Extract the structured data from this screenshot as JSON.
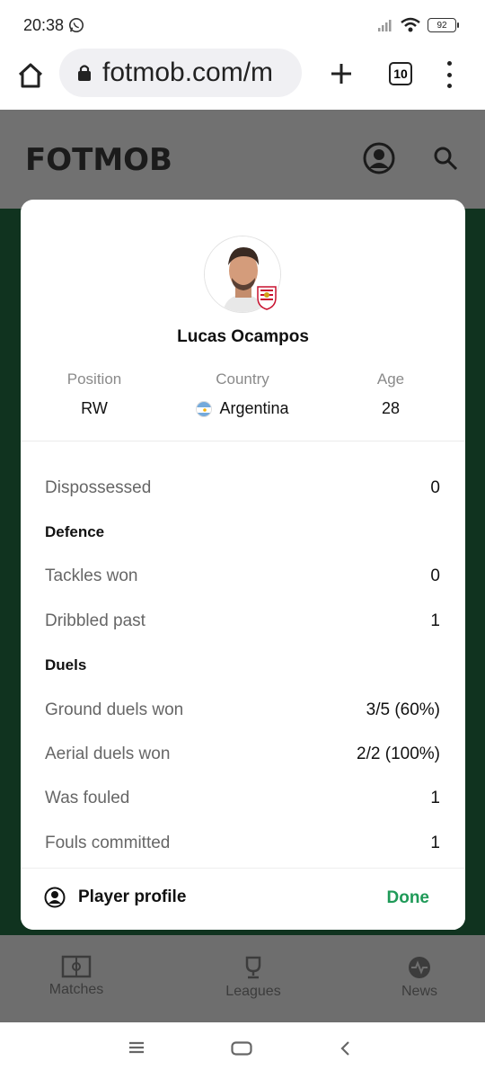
{
  "status_bar": {
    "time": "20:38",
    "battery": "92"
  },
  "browser": {
    "url": "fotmob.com/m",
    "tab_count": "10"
  },
  "site": {
    "logo": "FOTMOB",
    "bottom_nav": [
      {
        "label": "Matches",
        "icon": "pitch-icon"
      },
      {
        "label": "Leagues",
        "icon": "trophy-icon"
      },
      {
        "label": "News",
        "icon": "news-icon"
      }
    ]
  },
  "player": {
    "name": "Lucas Ocampos",
    "position_label": "Position",
    "position": "RW",
    "country_label": "Country",
    "country": "Argentina",
    "age_label": "Age",
    "age": "28"
  },
  "stats": [
    {
      "label": "Dispossessed",
      "value": "0",
      "header": false
    },
    {
      "label": "Defence",
      "value": "",
      "header": true
    },
    {
      "label": "Tackles won",
      "value": "0",
      "header": false
    },
    {
      "label": "Dribbled past",
      "value": "1",
      "header": false
    },
    {
      "label": "Duels",
      "value": "",
      "header": true
    },
    {
      "label": "Ground duels won",
      "value": "3/5 (60%)",
      "header": false
    },
    {
      "label": "Aerial duels won",
      "value": "2/2 (100%)",
      "header": false
    },
    {
      "label": "Was fouled",
      "value": "1",
      "header": false
    },
    {
      "label": "Fouls committed",
      "value": "1",
      "header": false
    }
  ],
  "footer": {
    "profile_label": "Player profile",
    "done_label": "Done"
  },
  "colors": {
    "accent": "#1f9a58",
    "page_green": "#10331f",
    "overlay_gray": "#717171"
  }
}
